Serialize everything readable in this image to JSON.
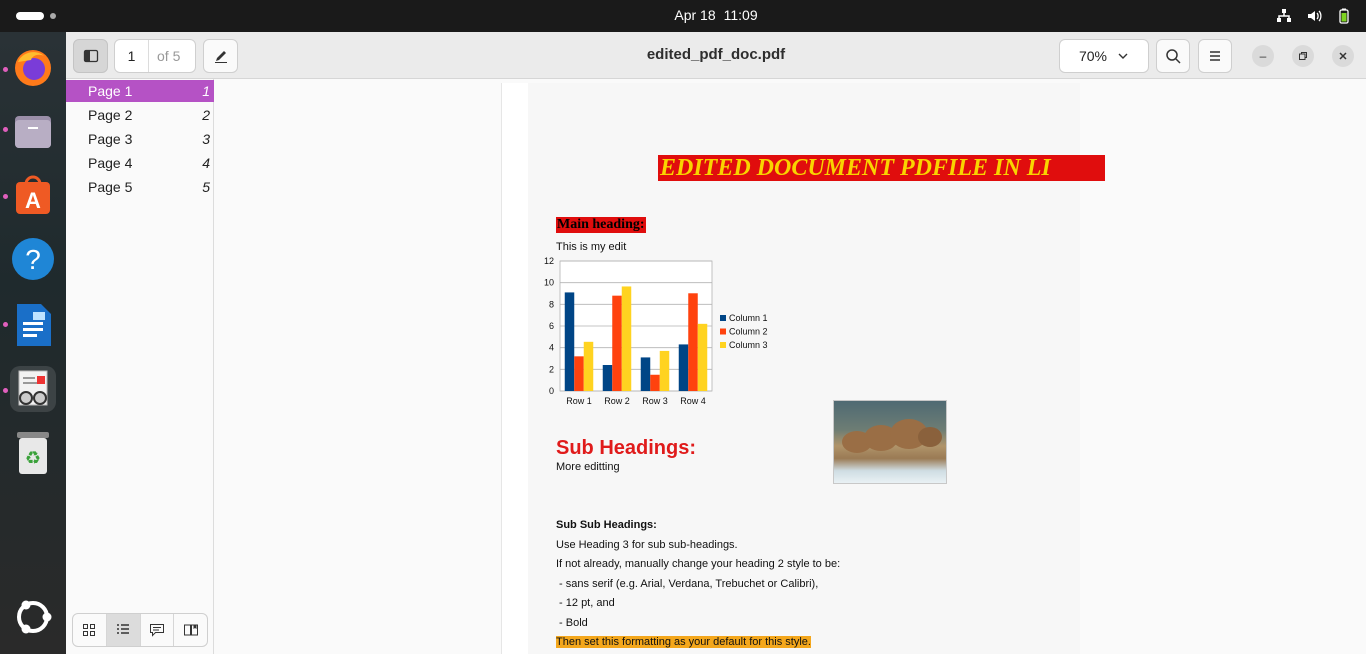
{
  "topbar": {
    "date": "Apr 18",
    "time": "11:09",
    "tray_icons": [
      "network-icon",
      "volume-icon",
      "battery-icon"
    ]
  },
  "dock": {
    "apps": [
      "firefox-icon",
      "files-icon",
      "app-center-icon",
      "help-icon",
      "writer-icon",
      "document-viewer-icon",
      "trash-icon"
    ],
    "ubuntu_logo": "ubuntu-logo-icon"
  },
  "headerbar": {
    "current_page": "1",
    "page_count": "of 5",
    "title": "edited_pdf_doc.pdf",
    "zoom": "70%"
  },
  "sidebar": {
    "pages": [
      {
        "label": "Page 1",
        "num": "1"
      },
      {
        "label": "Page 2",
        "num": "2"
      },
      {
        "label": "Page 3",
        "num": "3"
      },
      {
        "label": "Page 4",
        "num": "4"
      },
      {
        "label": "Page 5",
        "num": "5"
      }
    ],
    "selected": 0,
    "tabs": [
      "thumbnails-icon",
      "outline-icon",
      "annotations-icon",
      "bookmarks-icon"
    ]
  },
  "document": {
    "banner": "EDITED DOCUMENT PDFILE IN LI",
    "main_heading": "Main heading:",
    "edit_line": "This is my edit",
    "sub_heading": "Sub Headings:",
    "more_editing": "More editting",
    "subsub_heading": "Sub Sub Headings:",
    "lines": [
      "Use Heading 3 for sub sub-headings.",
      "If not already, manually change your heading 2 style to be:",
      " - sans serif (e.g. Arial, Verdana, Trebuchet or Calibri),",
      " - 12 pt, and",
      " - Bold"
    ],
    "highlight_line": "Then set this formatting as your default for this style."
  },
  "chart_data": {
    "type": "bar",
    "categories": [
      "Row 1",
      "Row 2",
      "Row 3",
      "Row 4"
    ],
    "series": [
      {
        "name": "Column 1",
        "values": [
          9.1,
          2.4,
          3.1,
          4.3
        ],
        "color": "#004586"
      },
      {
        "name": "Column 2",
        "values": [
          3.2,
          8.8,
          1.5,
          9.02
        ],
        "color": "#ff420e"
      },
      {
        "name": "Column 3",
        "values": [
          4.54,
          9.65,
          3.7,
          6.2
        ],
        "color": "#ffd320"
      }
    ],
    "ylim": [
      0,
      12
    ],
    "yticks": [
      "0",
      "2",
      "4",
      "6",
      "8",
      "10",
      "12"
    ],
    "grid": true,
    "legend": "right"
  }
}
